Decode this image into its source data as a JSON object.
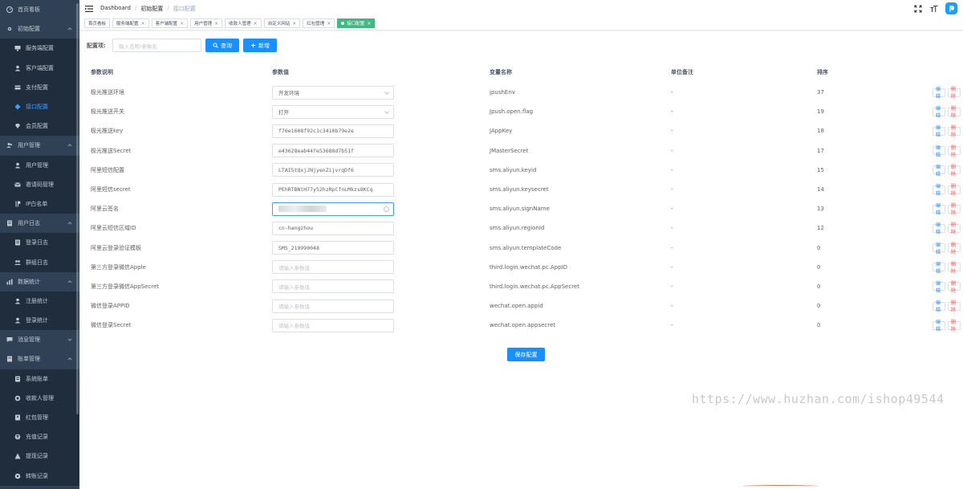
{
  "sidebar": {
    "items": [
      {
        "label": "首页看板",
        "level": "top",
        "icon": "dashboard-icon"
      },
      {
        "label": "初始配置",
        "level": "top",
        "icon": "settings-icon",
        "expanded": true
      },
      {
        "label": "服务端配置",
        "level": "sub",
        "icon": "monitor-icon"
      },
      {
        "label": "客户端配置",
        "level": "sub",
        "icon": "user-icon"
      },
      {
        "label": "支付配置",
        "level": "sub",
        "icon": "payment-icon"
      },
      {
        "label": "接口配置",
        "level": "sub",
        "icon": "api-icon",
        "active": true
      },
      {
        "label": "会员配置",
        "level": "sub",
        "icon": "diamond-icon"
      },
      {
        "label": "用户管理",
        "level": "top",
        "icon": "users-icon",
        "expanded": true
      },
      {
        "label": "用户管理",
        "level": "sub",
        "icon": "user-icon"
      },
      {
        "label": "邀请码管理",
        "level": "sub",
        "icon": "invite-icon"
      },
      {
        "label": "IP白名单",
        "level": "sub",
        "icon": "ip-icon"
      },
      {
        "label": "用户日志",
        "level": "top",
        "icon": "log-icon",
        "expanded": true
      },
      {
        "label": "登录日志",
        "level": "sub",
        "icon": "document-icon"
      },
      {
        "label": "群组日志",
        "level": "sub",
        "icon": "group-icon"
      },
      {
        "label": "数据统计",
        "level": "top",
        "icon": "chart-icon",
        "expanded": true
      },
      {
        "label": "注册统计",
        "level": "sub",
        "icon": "user-icon"
      },
      {
        "label": "登录统计",
        "level": "sub",
        "icon": "user-icon"
      },
      {
        "label": "消息管理",
        "level": "top",
        "icon": "message-icon",
        "expanded": false
      },
      {
        "label": "账单管理",
        "level": "top",
        "icon": "bill-icon",
        "expanded": true
      },
      {
        "label": "系统账单",
        "level": "sub",
        "icon": "document-icon"
      },
      {
        "label": "收款人管理",
        "level": "sub",
        "icon": "payee-icon"
      },
      {
        "label": "红包管理",
        "level": "sub",
        "icon": "redpacket-icon"
      },
      {
        "label": "充值记录",
        "level": "sub",
        "icon": "recharge-icon"
      },
      {
        "label": "提现记录",
        "level": "sub",
        "icon": "withdraw-icon"
      },
      {
        "label": "转账记录",
        "level": "sub",
        "icon": "transfer-icon"
      }
    ]
  },
  "breadcrumb": [
    "Dashboard",
    "初始配置",
    "接口配置"
  ],
  "tags": [
    {
      "label": "首页看板",
      "closable": false,
      "active": false
    },
    {
      "label": "服务端配置",
      "closable": true,
      "active": false
    },
    {
      "label": "客户端配置",
      "closable": true,
      "active": false
    },
    {
      "label": "用户管理",
      "closable": true,
      "active": false
    },
    {
      "label": "收款人管理",
      "closable": true,
      "active": false
    },
    {
      "label": "自定义网站",
      "closable": true,
      "active": false
    },
    {
      "label": "红包管理",
      "closable": true,
      "active": false
    },
    {
      "label": "接口配置",
      "closable": true,
      "active": true
    }
  ],
  "search": {
    "label": "配置项:",
    "placeholder": "输入名称/参数名",
    "query_label": "查询",
    "add_label": "新增"
  },
  "table": {
    "headers": [
      "参数说明",
      "参数值",
      "变量名称",
      "单位备注",
      "排序"
    ],
    "edit_label": "编辑",
    "delete_label": "删除",
    "rows": [
      {
        "desc": "极光推送环境",
        "value": "开发环境",
        "kind": "select",
        "var": "jpushEnv",
        "unit": "-",
        "sort": "37"
      },
      {
        "desc": "极光推送开关",
        "value": "打开",
        "kind": "select",
        "var": "Jpush.open.flag",
        "unit": "-",
        "sort": "19"
      },
      {
        "desc": "极光推送key",
        "value": "f76e1608f92c1c3410b79e2e",
        "kind": "text",
        "var": "JAppKey",
        "unit": "-",
        "sort": "18"
      },
      {
        "desc": "极光推送Secret",
        "value": "e43628eab44fe53688d7b51f",
        "kind": "text",
        "var": "JMasterSecret",
        "unit": "-",
        "sort": "17"
      },
      {
        "desc": "阿里短信配置",
        "value": "LTAI5tQxjJNjyenZijvrqDf6",
        "kind": "text",
        "var": "sms.aliyun.keyid",
        "unit": "-",
        "sort": "15"
      },
      {
        "desc": "阿里短信secret",
        "value": "PEhRTBNtH77y52hzRpCfnLMkzs8KCq",
        "kind": "text",
        "var": "sms.aliyun.keysecret",
        "unit": "-",
        "sort": "14"
      },
      {
        "desc": "阿里云签名",
        "value": "",
        "kind": "blurred",
        "var": "sms.aliyun.signName",
        "unit": "-",
        "sort": "13"
      },
      {
        "desc": "阿里云短信区域ID",
        "value": "cn-hangzhou",
        "kind": "text",
        "var": "sms.aliyun.regionId",
        "unit": "-",
        "sort": "12"
      },
      {
        "desc": "阿里云登录验证模板",
        "value": "SMS_219990048",
        "kind": "text",
        "var": "sms.aliyun.templateCode",
        "unit": "-",
        "sort": "0"
      },
      {
        "desc": "第三方登录微信Apple",
        "value": "请输入参数值",
        "kind": "placeholder",
        "var": "third.login.wechat.pc.AppID",
        "unit": "-",
        "sort": "0"
      },
      {
        "desc": "第三方登录微信AppSecret",
        "value": "请输入参数值",
        "kind": "placeholder",
        "var": "third.login.wechat.pc.AppSecret",
        "unit": "-",
        "sort": "0"
      },
      {
        "desc": "微信登录APPID",
        "value": "请输入参数值",
        "kind": "placeholder",
        "var": "wechat.open.appid",
        "unit": "-",
        "sort": "0"
      },
      {
        "desc": "微信登录Secret",
        "value": "请输入参数值",
        "kind": "placeholder",
        "var": "wechat.open.appsecret",
        "unit": "-",
        "sort": "0"
      }
    ]
  },
  "save_label": "保存配置",
  "watermark": "https://www.huzhan.com/ishop49544",
  "colors": {
    "sidebar": "#304156",
    "primary": "#1890ff",
    "active_tag": "#42b983",
    "danger": "#ff4949"
  }
}
